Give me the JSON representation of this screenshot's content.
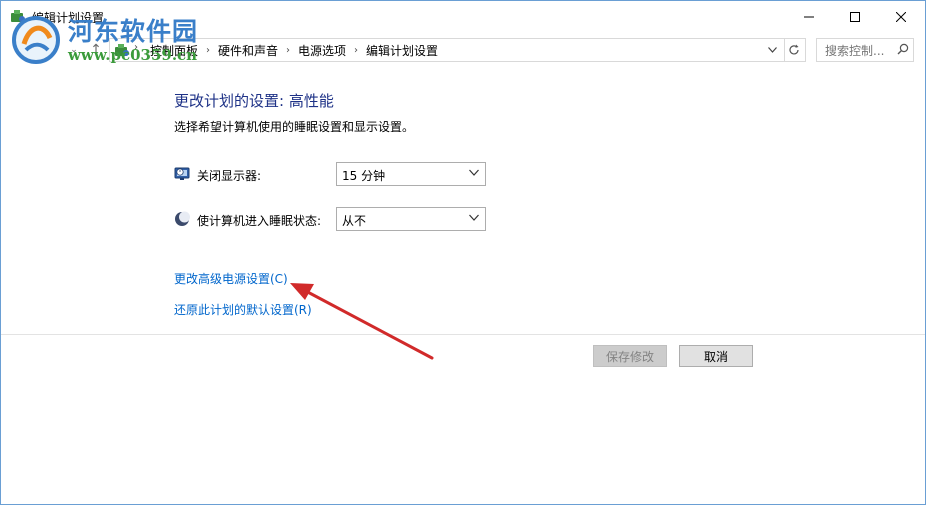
{
  "window": {
    "title": "编辑计划设置"
  },
  "address": {
    "breadcrumbs": [
      "控制面板",
      "硬件和声音",
      "电源选项",
      "编辑计划设置"
    ]
  },
  "search": {
    "placeholder": "搜索控制..."
  },
  "content": {
    "heading": "更改计划的设置: 高性能",
    "description": "选择希望计算机使用的睡眠设置和显示设置。",
    "display_off_label": "关闭显示器:",
    "display_off_value": "15 分钟",
    "sleep_label": "使计算机进入睡眠状态:",
    "sleep_value": "从不",
    "advanced_link": "更改高级电源设置(C)",
    "restore_link": "还原此计划的默认设置(R)"
  },
  "buttons": {
    "save": "保存修改",
    "cancel": "取消"
  },
  "watermark": {
    "line1": "河东软件园",
    "line2": "www.pc0359.cn"
  },
  "colors": {
    "heading": "#1e3287",
    "link": "#0066cc",
    "annotation_arrow": "#d12a2a"
  }
}
